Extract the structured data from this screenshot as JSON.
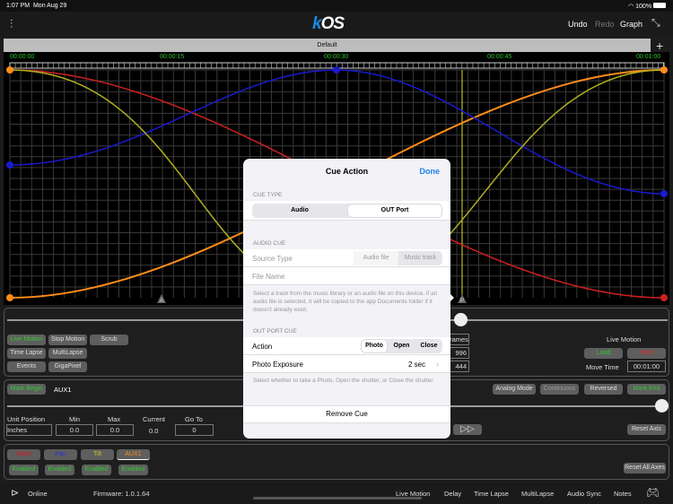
{
  "status": {
    "time": "1:07 PM",
    "date": "Mon Aug 29",
    "battery": "100%"
  },
  "header": {
    "logo_k": "k",
    "logo_os": "OS",
    "undo": "Undo",
    "redo": "Redo",
    "graph": "Graph"
  },
  "tab": {
    "label": "Default",
    "add": "+"
  },
  "timeline": {
    "labels": [
      "00:00:00",
      "00:00:15",
      "00:00:30",
      "00:00:45",
      "00:01:00"
    ],
    "markers": [
      "A",
      "P"
    ]
  },
  "colors": {
    "slider": "#d02020",
    "pan": "#1a1ad0",
    "tilt": "#b0b020",
    "aux1": "#ff8c1a"
  },
  "modes": {
    "live_motion": "Live Motion",
    "stop_motion": "Stop Motion",
    "scrub": "Scrub",
    "time_lapse": "Time Lapse",
    "multilapse": "MultiLapse",
    "events": "Events",
    "gigapixel": "GigaPixel"
  },
  "live": {
    "title": "Live Motion",
    "load": "Load",
    "stop": "Stop",
    "move_time_label": "Move Time",
    "move_time": "00:01:00",
    "frames_label": "rames",
    "v1": "996",
    "v2": "444"
  },
  "axis": {
    "mark_begin": "Mark Begin",
    "name": "AUX1",
    "analog": "Analog Mode",
    "continuous": "Continuous",
    "reversed": "Reversed",
    "mark_end": "Mark End",
    "unit_position": "Unit Position",
    "min": "Min",
    "max": "Max",
    "current": "Current",
    "goto": "Go To",
    "unit_value": "Inches",
    "min_value": "0.0",
    "max_value": "0.0",
    "current_value": "0.0",
    "goto_value": "0",
    "reset_axis": "Reset Axis"
  },
  "axes": {
    "tabs": [
      "Slider",
      "Pan",
      "Tilt",
      "AUX1"
    ],
    "enabled": "Enabled",
    "reset_all": "Reset All Axes"
  },
  "footer": {
    "online": "Online",
    "firmware": "Firmware: 1.0.1.64",
    "nav": [
      "Live Motion",
      "Delay",
      "Time Lapse",
      "MultiLapse",
      "Audio Sync",
      "Notes"
    ]
  },
  "modal": {
    "title": "Cue Action",
    "done": "Done",
    "cue_type": "CUE TYPE",
    "audio": "Audio",
    "out_port": "OUT Port",
    "audio_cue": "AUDIO CUE",
    "source_type": "Source Type",
    "audio_file": "Audio file",
    "music_track": "Music track",
    "file_name": "File Name",
    "audio_note": "Select a track from the music library or an audio file on this device. if an audio file is selected, it will be copied to the app Documents folder if it doesn't already exist.",
    "out_port_cue": "OUT PORT CUE",
    "action": "Action",
    "photo": "Photo",
    "open": "Open",
    "close": "Close",
    "photo_exposure": "Photo Exposure",
    "exposure_value": "2 sec",
    "out_note": "Select whether to take a Photo, Open the shutter, or Close the shutter.",
    "remove": "Remove Cue"
  }
}
